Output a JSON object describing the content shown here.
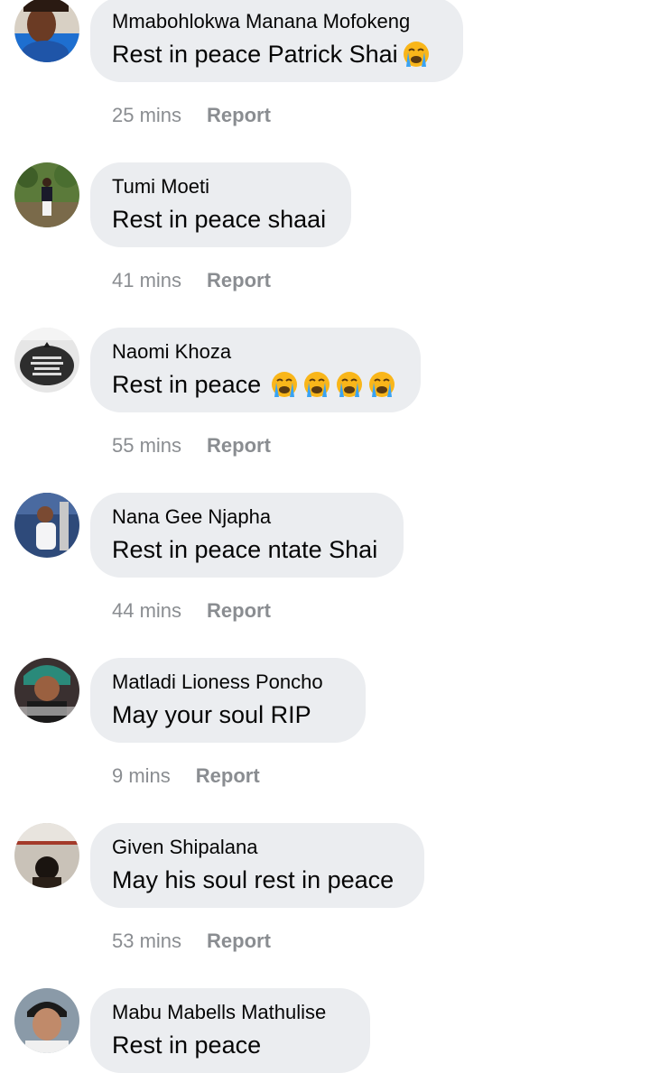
{
  "comments": [
    {
      "author": "Mmabohlokwa Manana Mofokeng",
      "text": "Rest in peace Patrick Shai",
      "emoji_count": 1,
      "emoji": "crying-face",
      "time": "25 mins",
      "report": "Report",
      "avatar": "person-avatar"
    },
    {
      "author": "Tumi Moeti",
      "text": "Rest in peace shaai",
      "emoji_count": 0,
      "time": "41 mins",
      "report": "Report",
      "avatar": "person-avatar"
    },
    {
      "author": "Naomi Khoza",
      "text": "Rest in peace",
      "emoji_count": 4,
      "emoji": "crying-face",
      "time": "55 mins",
      "report": "Report",
      "avatar": "memorial-sign-avatar"
    },
    {
      "author": "Nana Gee Njapha",
      "text": "Rest in peace ntate Shai",
      "emoji_count": 0,
      "time": "44 mins",
      "report": "Report",
      "avatar": "person-avatar"
    },
    {
      "author": "Matladi Lioness Poncho",
      "text": "May your soul RIP",
      "emoji_count": 0,
      "time": "9 mins",
      "report": "Report",
      "avatar": "person-avatar"
    },
    {
      "author": "Given Shipalana",
      "text": "May his soul rest in peace",
      "emoji_count": 0,
      "time": "53 mins",
      "report": "Report",
      "avatar": "person-avatar"
    },
    {
      "author": "Mabu Mabells Mathulise",
      "text": "Rest in peace",
      "emoji_count": 0,
      "time": "",
      "report": "",
      "avatar": "person-avatar"
    }
  ],
  "colors": {
    "bubble": "#ebedf0",
    "meta_text": "#8a8d91",
    "primary_text": "#050505",
    "emoji_face": "#f9b61a",
    "tears": "#3aa3f2"
  }
}
